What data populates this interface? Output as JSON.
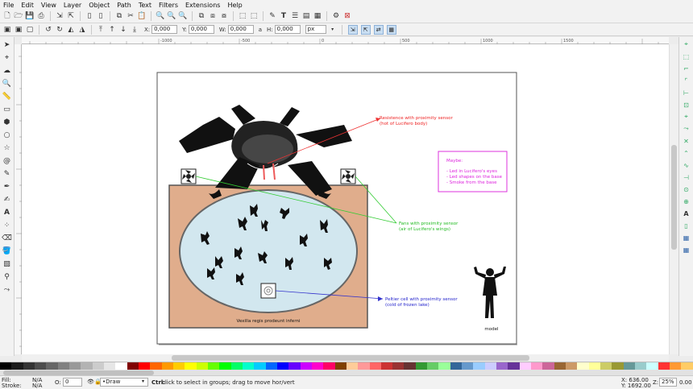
{
  "menu": [
    "File",
    "Edit",
    "View",
    "Layer",
    "Object",
    "Path",
    "Text",
    "Filters",
    "Extensions",
    "Help"
  ],
  "toolbar2": {
    "x_label": "X:",
    "x_value": "0,000",
    "y_label": "Y:",
    "y_value": "0,000",
    "w_label": "W:",
    "w_value": "0,000",
    "lock_glyph": "a",
    "h_label": "H:",
    "h_value": "0,000",
    "unit": "px"
  },
  "ruler_marks": [
    "-1000",
    "-500",
    "0",
    "500",
    "1000",
    "1500"
  ],
  "drawing": {
    "label_red": [
      "Resistence with proximity sensor",
      "(hot of Lucifero body)"
    ],
    "label_green": [
      "Fans with proximity sensor",
      "(air of Lucifero's wings)"
    ],
    "label_blue": [
      "Peltier cell with proximity sensor",
      "(cold of frozen lake)"
    ],
    "maybe_title": "Maybe:",
    "maybe_items": [
      "- Led in Lucifero's eyes",
      "- Led shapes on the base",
      "- Smoke from the base"
    ],
    "base_caption": "Vexilla regis prodeunt inferni",
    "model_caption": "model"
  },
  "status": {
    "fill_label": "Fill:",
    "fill_value": "N/A",
    "stroke_label": "Stroke:",
    "stroke_value": "N/A",
    "opacity_label": "O:",
    "opacity_value": "0",
    "layer": "•Draw",
    "hint_bold": "Ctrl:",
    "hint": " click to select in groups; drag to move hor/vert",
    "x_coord": "X: 636.00",
    "y_coord": "Y: 1692.00",
    "zoom_label": "Z:",
    "zoom_value": "25%",
    "rotation_value": "0.00"
  },
  "palette_colors": [
    "#000000",
    "#1a1a1a",
    "#333333",
    "#4d4d4d",
    "#666666",
    "#808080",
    "#999999",
    "#b3b3b3",
    "#cccccc",
    "#e6e6e6",
    "#ffffff",
    "#800000",
    "#ff0000",
    "#ff6600",
    "#ff9900",
    "#ffcc00",
    "#ffff00",
    "#ccff00",
    "#66ff00",
    "#00ff00",
    "#00ff66",
    "#00ffcc",
    "#00ccff",
    "#0066ff",
    "#0000ff",
    "#6600ff",
    "#cc00ff",
    "#ff00cc",
    "#ff0066",
    "#804000",
    "#ffcc99",
    "#ff9999",
    "#ff6666",
    "#cc3333",
    "#993333",
    "#663333",
    "#339933",
    "#66cc66",
    "#99ff99",
    "#336699",
    "#6699cc",
    "#99ccff",
    "#ccccff",
    "#9966cc",
    "#663399",
    "#ffccff",
    "#ff99cc",
    "#cc6699",
    "#996633",
    "#cc9966",
    "#ffffcc",
    "#ffff99",
    "#cccc66",
    "#999933",
    "#669999",
    "#99cccc",
    "#ccffff",
    "#ff3333",
    "#ff9933",
    "#ffcc66"
  ]
}
